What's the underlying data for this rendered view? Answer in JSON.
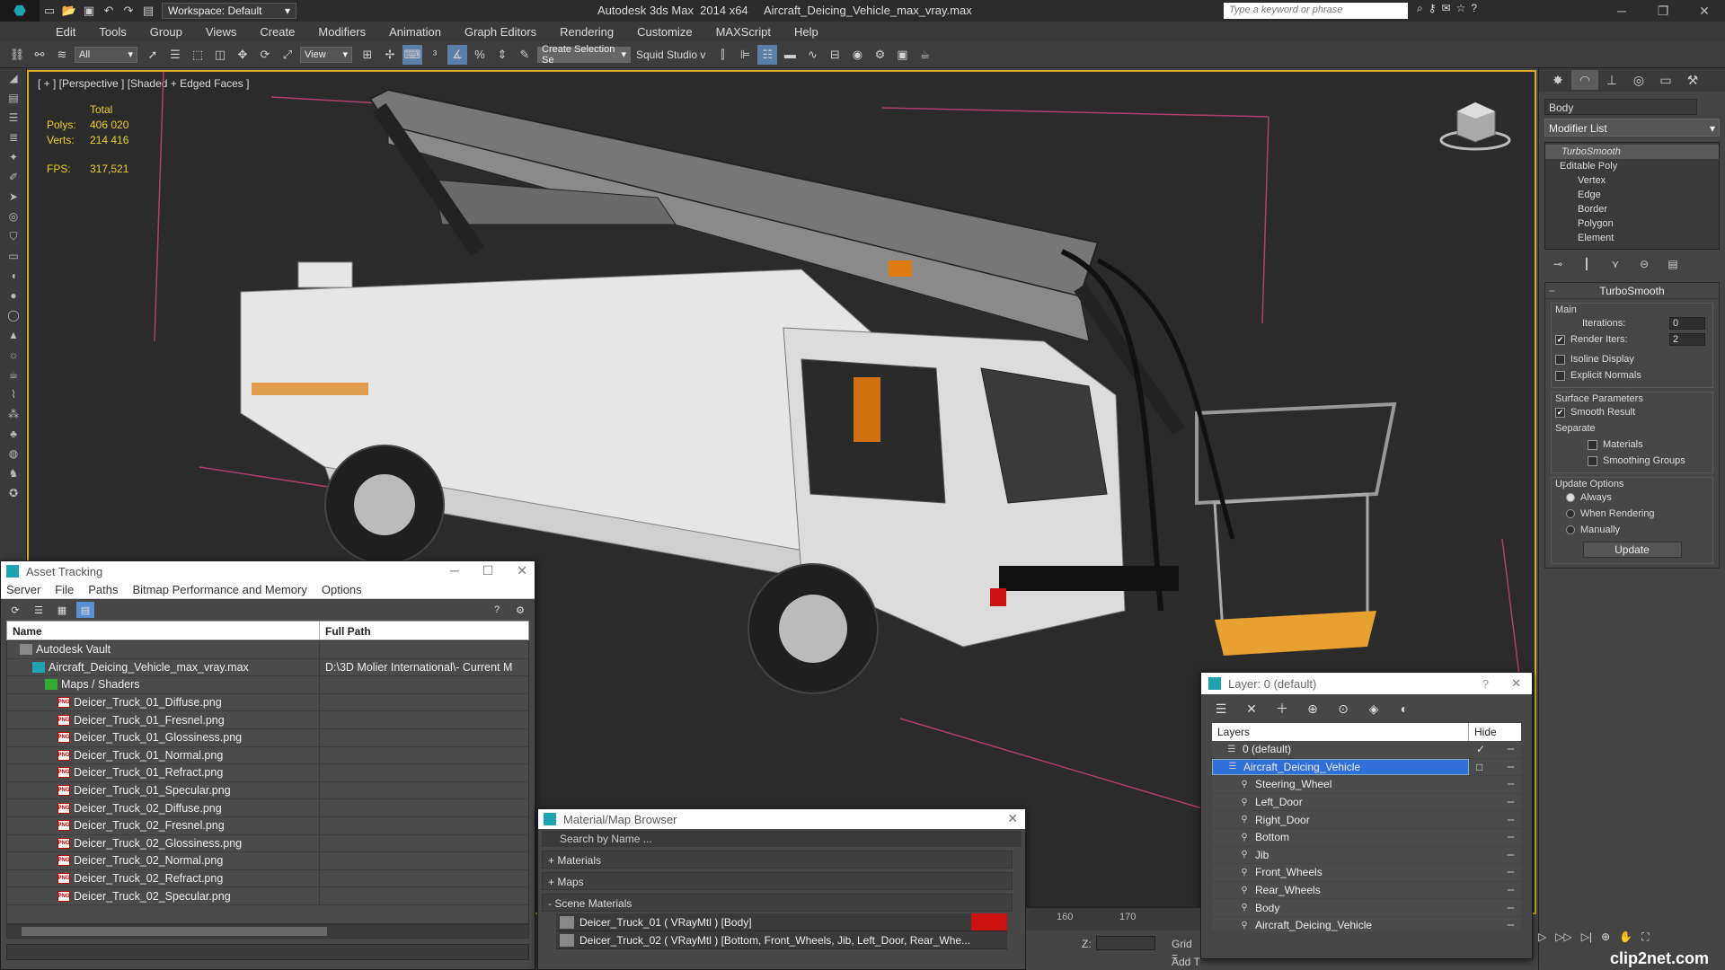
{
  "title_bar": {
    "workspace": "Workspace: Default",
    "app_title": "Autodesk 3ds Max  2014 x64     Aircraft_Deicing_Vehicle_max_vray.max",
    "search_placeholder": "Type a keyword or phrase"
  },
  "menu": [
    "Edit",
    "Tools",
    "Group",
    "Views",
    "Create",
    "Modifiers",
    "Animation",
    "Graph Editors",
    "Rendering",
    "Customize",
    "MAXScript",
    "Help"
  ],
  "toolbar": {
    "selection_filter": "All",
    "reference_coord": "View",
    "selection_set_placeholder": "Create Selection Se",
    "squid_label": "Squid Studio v"
  },
  "viewport": {
    "label": "[ + ] [Perspective ] [Shaded + Edged Faces ]",
    "stats": {
      "header": "Total",
      "polys_label": "Polys:",
      "polys_value": "406 020",
      "verts_label": "Verts:",
      "verts_value": "214 416",
      "fps_label": "FPS:",
      "fps_value": "317,521"
    }
  },
  "command_panel": {
    "object_name": "Body",
    "modifier_list": "Modifier List",
    "stack": {
      "modifier": "TurboSmooth",
      "base": "Editable Poly",
      "subobjects": [
        "Vertex",
        "Edge",
        "Border",
        "Polygon",
        "Element"
      ]
    },
    "turbosmooth": {
      "title": "TurboSmooth",
      "main_label": "Main",
      "iterations_label": "Iterations:",
      "iterations_value": "0",
      "render_iters_label": "Render Iters:",
      "render_iters_value": "2",
      "isoline_label": "Isoline Display",
      "explicit_label": "Explicit Normals",
      "surface_label": "Surface Parameters",
      "smooth_result_label": "Smooth Result",
      "separate_label": "Separate",
      "materials_label": "Materials",
      "smoothing_groups_label": "Smoothing Groups",
      "update_options_label": "Update Options",
      "always_label": "Always",
      "when_rendering_label": "When Rendering",
      "manually_label": "Manually",
      "update_button": "Update"
    }
  },
  "asset_tracking": {
    "title": "Asset Tracking",
    "menu": [
      "Server",
      "File",
      "Paths",
      "Bitmap Performance and Memory",
      "Options"
    ],
    "col_name": "Name",
    "col_path": "Full Path",
    "rows": [
      {
        "name": "Autodesk Vault",
        "path": "",
        "indent": 1,
        "icon": "vault"
      },
      {
        "name": "Aircraft_Deicing_Vehicle_max_vray.max",
        "path": "D:\\3D Molier International\\- Current M",
        "indent": 2,
        "icon": "max"
      },
      {
        "name": "Maps / Shaders",
        "path": "",
        "indent": 3,
        "icon": "maps"
      },
      {
        "name": "Deicer_Truck_01_Diffuse.png",
        "path": "",
        "indent": 4,
        "icon": "png"
      },
      {
        "name": "Deicer_Truck_01_Fresnel.png",
        "path": "",
        "indent": 4,
        "icon": "png"
      },
      {
        "name": "Deicer_Truck_01_Glossiness.png",
        "path": "",
        "indent": 4,
        "icon": "png"
      },
      {
        "name": "Deicer_Truck_01_Normal.png",
        "path": "",
        "indent": 4,
        "icon": "png"
      },
      {
        "name": "Deicer_Truck_01_Refract.png",
        "path": "",
        "indent": 4,
        "icon": "png"
      },
      {
        "name": "Deicer_Truck_01_Specular.png",
        "path": "",
        "indent": 4,
        "icon": "png"
      },
      {
        "name": "Deicer_Truck_02_Diffuse.png",
        "path": "",
        "indent": 4,
        "icon": "png"
      },
      {
        "name": "Deicer_Truck_02_Fresnel.png",
        "path": "",
        "indent": 4,
        "icon": "png"
      },
      {
        "name": "Deicer_Truck_02_Glossiness.png",
        "path": "",
        "indent": 4,
        "icon": "png"
      },
      {
        "name": "Deicer_Truck_02_Normal.png",
        "path": "",
        "indent": 4,
        "icon": "png"
      },
      {
        "name": "Deicer_Truck_02_Refract.png",
        "path": "",
        "indent": 4,
        "icon": "png"
      },
      {
        "name": "Deicer_Truck_02_Specular.png",
        "path": "",
        "indent": 4,
        "icon": "png"
      }
    ]
  },
  "material_browser": {
    "title": "Material/Map Browser",
    "search_placeholder": "Search by Name ...",
    "sections": [
      "+ Materials",
      "+ Maps",
      "- Scene Materials"
    ],
    "items": [
      "Deicer_Truck_01  ( VRayMtl ) [Body]",
      "Deicer_Truck_02  ( VRayMtl )  [Bottom, Front_Wheels, Jib, Left_Door, Rear_Whe..."
    ]
  },
  "layers": {
    "title": "Layer: 0 (default)",
    "help": "?",
    "col_layers": "Layers",
    "col_hide": "Hide",
    "rows": [
      {
        "name": "0 (default)",
        "level": 1,
        "selected": false,
        "check": "✓"
      },
      {
        "name": "Aircraft_Deicing_Vehicle",
        "level": 1,
        "selected": true,
        "check": "□"
      },
      {
        "name": "Steering_Wheel",
        "level": 2,
        "selected": false,
        "check": ""
      },
      {
        "name": "Left_Door",
        "level": 2,
        "selected": false,
        "check": ""
      },
      {
        "name": "Right_Door",
        "level": 2,
        "selected": false,
        "check": ""
      },
      {
        "name": "Bottom",
        "level": 2,
        "selected": false,
        "check": ""
      },
      {
        "name": "Jib",
        "level": 2,
        "selected": false,
        "check": ""
      },
      {
        "name": "Front_Wheels",
        "level": 2,
        "selected": false,
        "check": ""
      },
      {
        "name": "Rear_Wheels",
        "level": 2,
        "selected": false,
        "check": ""
      },
      {
        "name": "Body",
        "level": 2,
        "selected": false,
        "check": ""
      },
      {
        "name": "Aircraft_Deicing_Vehicle",
        "level": 2,
        "selected": false,
        "check": ""
      }
    ]
  },
  "timeline": {
    "ticks": [
      "160",
      "170"
    ]
  },
  "status": {
    "z_label": "Z:",
    "grid_label": "Grid =",
    "add_time_tag": "Add T"
  },
  "watermark": "clip2net.com",
  "colors": {
    "accent": "#d7a92b",
    "selection": "#2f6fd8",
    "stats": "#f0d020",
    "brand": "#1fa3b0"
  }
}
